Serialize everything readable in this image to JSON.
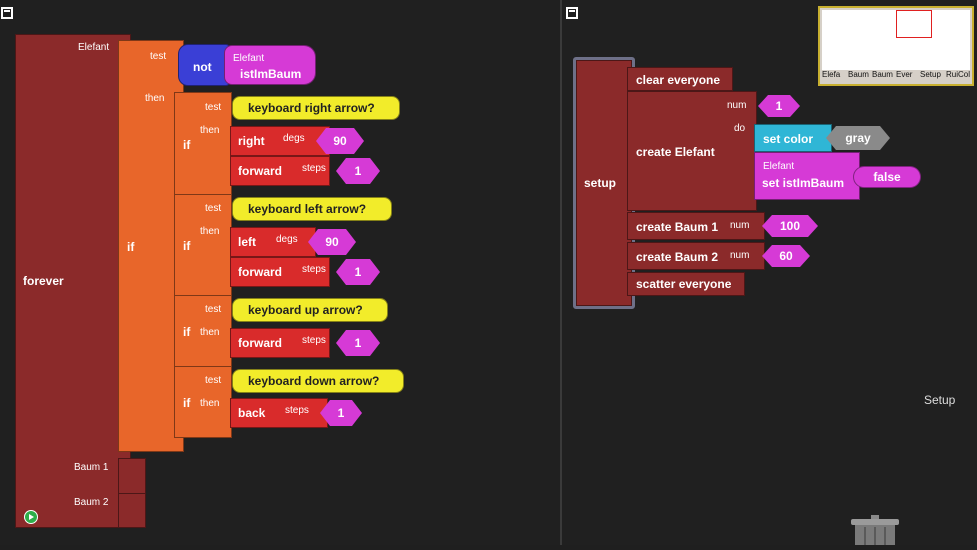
{
  "left_pane": {
    "forever_block": {
      "label": "forever",
      "breed_labels": [
        "Elefant",
        "Baum 1",
        "Baum 2"
      ]
    },
    "if_block": {
      "label": "if",
      "test_label": "test",
      "then_label": "then",
      "not_label": "not",
      "getter_breed": "Elefant",
      "getter_property": "istImBaum"
    },
    "inner_ifs": [
      {
        "label": "if",
        "test_label": "test",
        "then_label": "then",
        "condition": "keyboard right arrow?",
        "commands": [
          {
            "label": "right",
            "param_label": "degs",
            "value": "90"
          },
          {
            "label": "forward",
            "param_label": "steps",
            "value": "1"
          }
        ]
      },
      {
        "label": "if",
        "test_label": "test",
        "then_label": "then",
        "condition": "keyboard left arrow?",
        "commands": [
          {
            "label": "left",
            "param_label": "degs",
            "value": "90"
          },
          {
            "label": "forward",
            "param_label": "steps",
            "value": "1"
          }
        ]
      },
      {
        "label": "if",
        "test_label": "test",
        "then_label": "then",
        "condition": "keyboard up arrow?",
        "commands": [
          {
            "label": "forward",
            "param_label": "steps",
            "value": "1"
          }
        ]
      },
      {
        "label": "if",
        "test_label": "test",
        "then_label": "then",
        "condition": "keyboard down arrow?",
        "commands": [
          {
            "label": "back",
            "param_label": "steps",
            "value": "1"
          }
        ]
      }
    ]
  },
  "right_pane": {
    "setup_block": {
      "label": "setup",
      "clear_label": "clear everyone",
      "create_elefant": {
        "label": "create Elefant",
        "num_label": "num",
        "num_value": "1",
        "do_label": "do"
      },
      "set_color": {
        "label": "set color",
        "value": "gray"
      },
      "set_istimbaum": {
        "breed": "Elefant",
        "label": "set istImBaum",
        "value": "false"
      },
      "create_baum1": {
        "label": "create Baum 1",
        "num_label": "num",
        "num_value": "100"
      },
      "create_baum2": {
        "label": "create Baum 2",
        "num_label": "num",
        "num_value": "60"
      },
      "scatter_label": "scatter everyone"
    },
    "caption": "Setup",
    "minimap_tabs": [
      "Elefa",
      "Baum",
      "Baum",
      "Ever",
      "Setup",
      "RuiCol"
    ]
  }
}
